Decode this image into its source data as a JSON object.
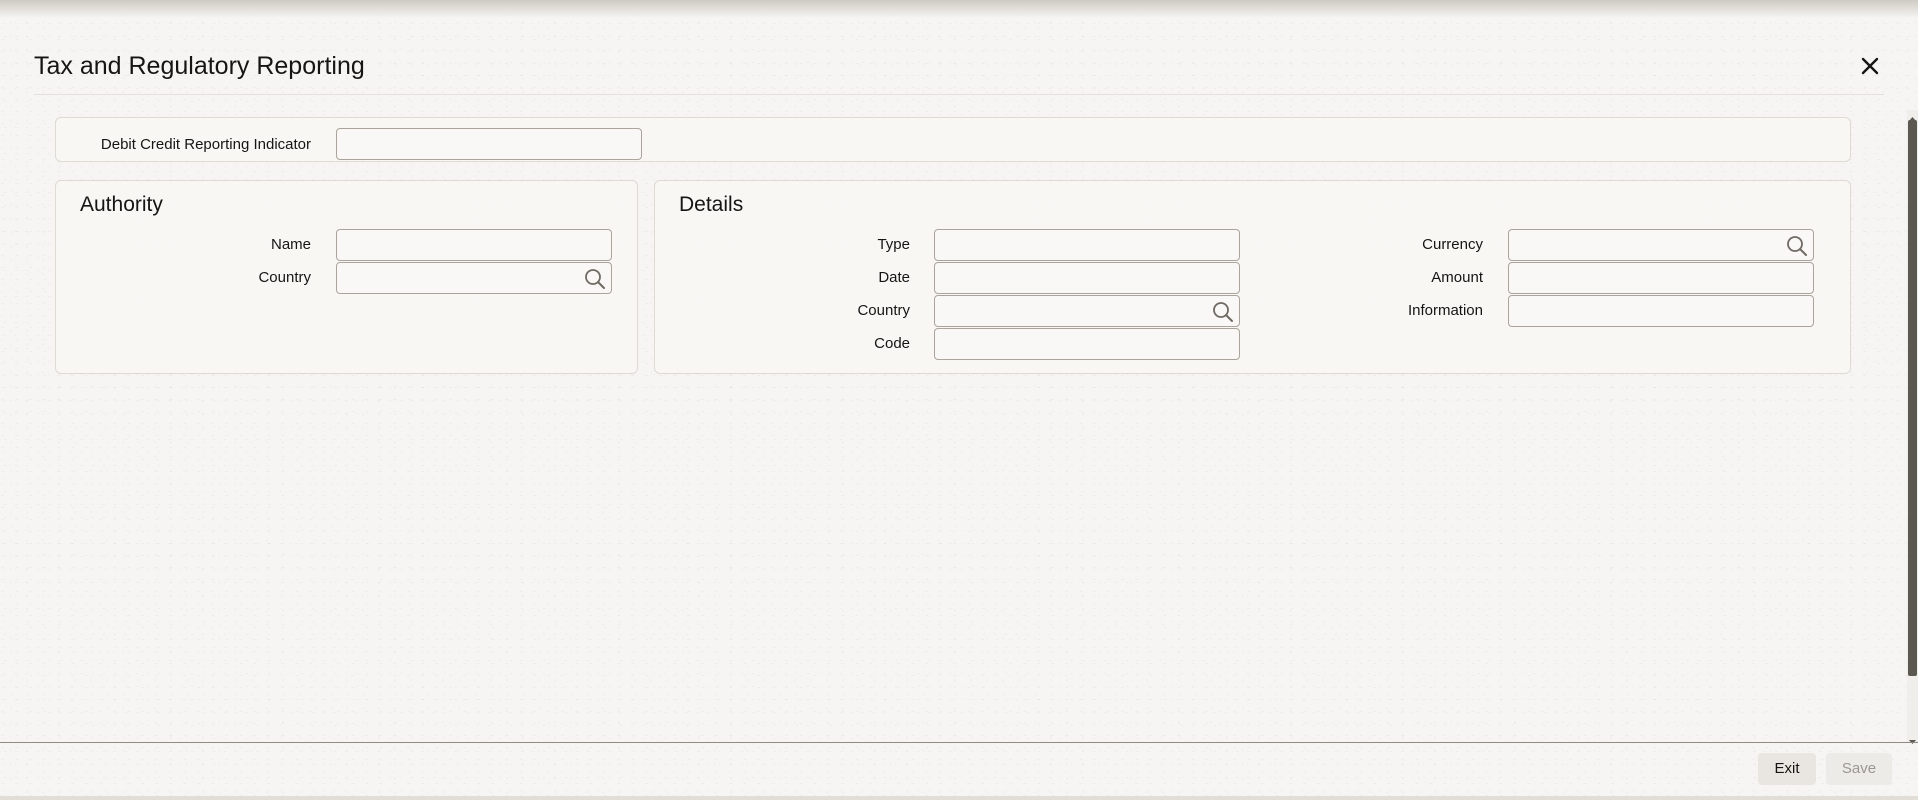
{
  "dialog": {
    "title": "Tax and Regulatory Reporting"
  },
  "header_row": {
    "debit_credit_label": "Debit Credit Reporting Indicator",
    "debit_credit_value": ""
  },
  "authority": {
    "title": "Authority",
    "name_label": "Name",
    "name_value": "",
    "country_label": "Country",
    "country_value": ""
  },
  "details": {
    "title": "Details",
    "type_label": "Type",
    "type_value": "",
    "date_label": "Date",
    "date_value": "",
    "country_label": "Country",
    "country_value": "",
    "code_label": "Code",
    "code_value": "",
    "currency_label": "Currency",
    "currency_value": "",
    "amount_label": "Amount",
    "amount_value": "",
    "information_label": "Information",
    "information_value": ""
  },
  "footer": {
    "exit_label": "Exit",
    "save_label": "Save"
  },
  "icons": {
    "close": "close-icon",
    "lookup": "search-icon"
  }
}
